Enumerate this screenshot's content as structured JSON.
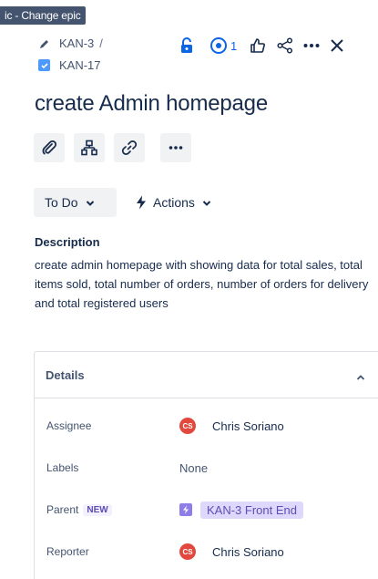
{
  "tooltip": "ic - Change epic",
  "breadcrumb": {
    "parent_key": "KAN-3",
    "separator": "/",
    "issue_key": "KAN-17"
  },
  "toolbar": {
    "watch_count": "1",
    "icons": [
      "lock-icon",
      "eye-icon",
      "thumbs-up-icon",
      "share-icon",
      "more-icon",
      "close-icon"
    ],
    "accent_color": "#0c66e4",
    "lock_color": "#0c66e4"
  },
  "issue": {
    "title": "create Admin homepage"
  },
  "quick_actions": [
    "paperclip-icon",
    "child-issues-icon",
    "link-icon",
    "more-icon"
  ],
  "status": {
    "label": "To Do"
  },
  "actions": {
    "label": "Actions"
  },
  "description": {
    "heading": "Description",
    "body": "create admin homepage with showing data for total sales, total items sold, total number of orders, number of orders for delivery and total registered users"
  },
  "details": {
    "heading": "Details",
    "assignee": {
      "label": "Assignee",
      "initials": "CS",
      "name": "Chris Soriano"
    },
    "labels": {
      "label": "Labels",
      "value": "None"
    },
    "parent": {
      "label": "Parent",
      "badge": "NEW",
      "value": "KAN-3 Front End"
    },
    "reporter": {
      "label": "Reporter",
      "initials": "CS",
      "name": "Chris Soriano"
    }
  },
  "colors": {
    "avatar": "#e2483d",
    "epic": "#8f7ee7",
    "parent_chip_bg": "#dfd8fd",
    "button_bg": "#f1f2f4"
  }
}
